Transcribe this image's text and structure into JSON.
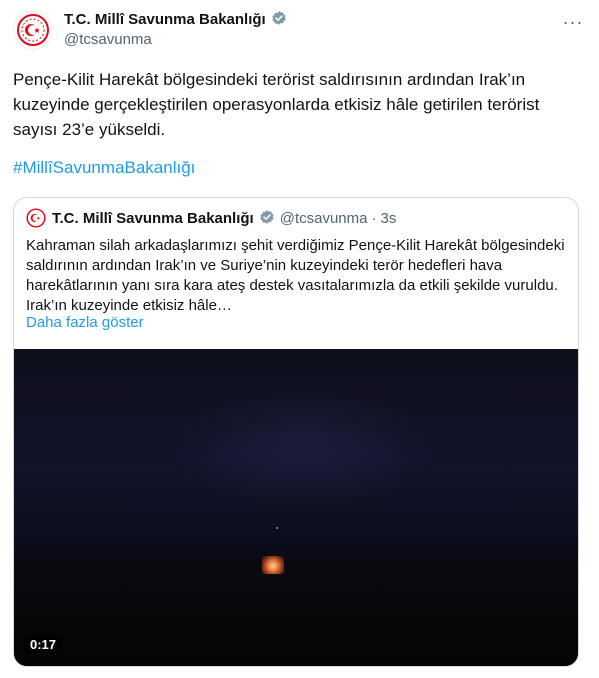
{
  "tweet": {
    "author_name": "T.C. Millî Savunma Bakanlığı",
    "author_handle": "@tcsavunma",
    "more_icon": "···",
    "text": "Pençe-Kilit Harekât bölgesindeki terörist saldırısının ardından Irak’ın kuzeyinde gerçekleştirilen operasyonlarda etkisiz hâle getirilen terörist sayısı 23’e yükseldi.",
    "hashtag": "#MillîSavunmaBakanlığı"
  },
  "quote": {
    "author_name": "T.C. Millî Savunma Bakanlığı",
    "author_handle": "@tcsavunma",
    "separator": "·",
    "time": "3s",
    "text": "Kahraman silah arkadaşlarımızı şehit verdiğimiz Pençe-Kilit Harekât bölgesindeki saldırının ardından Irak’ın ve Suriye’nin kuzeyindeki terör hedefleri hava harekâtlarının yanı sıra kara ateş destek vasıtalarımızla da etkili şekilde vuruldu. Irak’ın kuzeyinde etkisiz hâle…",
    "show_more": "Daha fazla göster",
    "video_timecode": "0:17"
  },
  "colors": {
    "accent": "#1d9bf0",
    "text": "#0f1419",
    "muted": "#536471",
    "border": "#cfd9de",
    "logo_red": "#e30a17"
  },
  "icons": {
    "avatar": "ministry-emblem-icon",
    "verified": "verified-badge-icon",
    "more": "more-icon"
  }
}
